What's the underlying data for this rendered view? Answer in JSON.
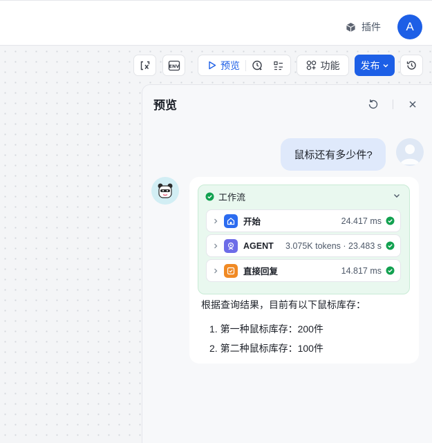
{
  "topbar": {
    "plugin_label": "插件",
    "avatar_letter": "A"
  },
  "toolbar": {
    "preview_label": "预览",
    "features_label": "功能",
    "publish_label": "发布"
  },
  "panel": {
    "title": "预览"
  },
  "chat": {
    "user_message": "鼠标还有多少件?",
    "workflow": {
      "label": "工作流",
      "steps": [
        {
          "name": "开始",
          "meta": "24.417 ms",
          "icon": "home-icon",
          "color": "#2c6cf0"
        },
        {
          "name": "AGENT",
          "meta": "3.075K tokens · 23.483 s",
          "icon": "agent-icon",
          "color": "#6d6ce8"
        },
        {
          "name": "直接回复",
          "meta": "14.817 ms",
          "icon": "reply-icon",
          "color": "#f08a24"
        }
      ]
    },
    "answer_intro": "根据查询结果，目前有以下鼠标库存：",
    "answer_items": [
      "1. 第一种鼠标库存：200件",
      "2. 第二种鼠标库存：100件"
    ]
  },
  "colors": {
    "accent": "#1d5fe6",
    "success": "#12a150",
    "workflow_bg": "#e9f8ef"
  }
}
